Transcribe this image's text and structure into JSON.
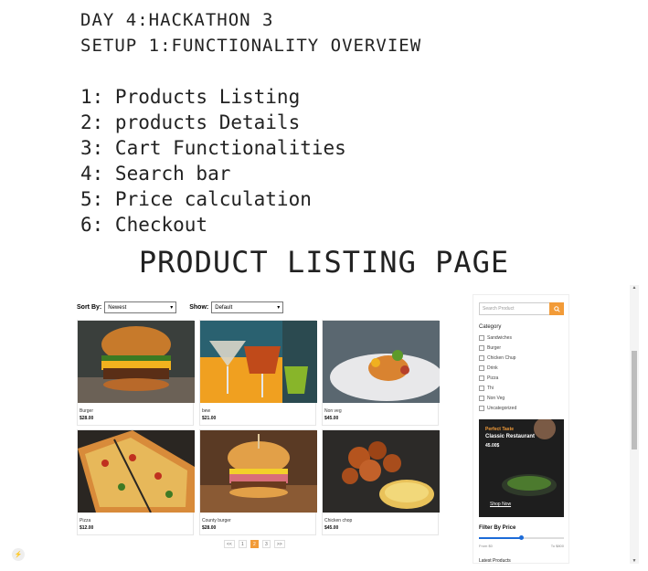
{
  "notes": {
    "line1": "DAY 4:HACKATHON 3",
    "line2": "SETUP 1:FUNCTIONALITY OVERVIEW",
    "items": [
      "1: Products Listing",
      "2: products Details",
      "3: Cart Functionalities",
      "4: Search bar",
      "5: Price calculation",
      "6: Checkout"
    ]
  },
  "section_title": "PRODUCT LISTING PAGE",
  "controls": {
    "sort_label": "Sort By:",
    "sort_value": "Newest",
    "show_label": "Show:",
    "show_value": "Default"
  },
  "products": [
    {
      "name": "Burger",
      "price": "$28.00"
    },
    {
      "name": "bew",
      "price": "$21.00"
    },
    {
      "name": "Non veg",
      "price": "$45.00"
    },
    {
      "name": "Pizza",
      "price": "$12.00"
    },
    {
      "name": "County burger",
      "price": "$28.00"
    },
    {
      "name": "Chicken chop",
      "price": "$45.00"
    }
  ],
  "pagination": {
    "prev": "<<",
    "pages": [
      "1",
      "2",
      "3"
    ],
    "active": "2",
    "next": ">>"
  },
  "sidebar": {
    "search_placeholder": "Search Product",
    "category_title": "Category",
    "categories": [
      "Sandwiches",
      "Burger",
      "Chicken Chup",
      "Drink",
      "Pizza",
      "Thi",
      "Non Veg",
      "Uncategorized"
    ],
    "banner": {
      "tag": "Perfect Taste",
      "title": "Classic Restaurant",
      "price": "45.00$",
      "cta": "Shop Now"
    },
    "filter_title": "Filter By Price",
    "price_fill_fraction": 0.5,
    "range_from": "From $0",
    "range_to": "To $800",
    "latest_title": "Latest Products"
  },
  "colors": {
    "accent": "#f29b38",
    "slider": "#1c6bd8"
  }
}
